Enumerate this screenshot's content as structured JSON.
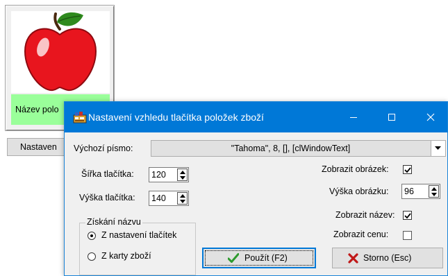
{
  "preview": {
    "name_label": "Název polo",
    "settings_button_label": "Nastaven"
  },
  "dialog": {
    "title": "Nastavení vzhledu tlačítka položek zboží",
    "font_label": "Výchozí písmo:",
    "font_value": "\"Tahoma\", 8, [], [clWindowText]",
    "width_label": "Šířka tlačítka:",
    "width_value": "120",
    "height_label": "Výška tlačítka:",
    "height_value": "140",
    "show_image_label": "Zobrazit obrázek:",
    "show_image_checked": true,
    "image_height_label": "Výška obrázku:",
    "image_height_value": "96",
    "show_name_label": "Zobrazit název:",
    "show_name_checked": true,
    "show_price_label": "Zobrazit cenu:",
    "show_price_checked": false,
    "name_source": {
      "legend": "Získání názvu",
      "option_button_settings": "Z nastavení tlačítek",
      "option_product_card": "Z karty zboží",
      "selected": "option_button_settings"
    },
    "apply_button": "Použít (F2)",
    "cancel_button": "Storno (Esc)"
  },
  "colors": {
    "titlebar": "#0078d7",
    "name_area": "#9aff9a",
    "apply_check": "#2e9a2e",
    "cancel_x": "#c01818"
  },
  "icons": [
    "app-icon",
    "minimize-icon",
    "maximize-icon",
    "close-icon",
    "dropdown-arrow-icon",
    "checkmark-icon",
    "cancel-x-icon",
    "apple-image"
  ]
}
